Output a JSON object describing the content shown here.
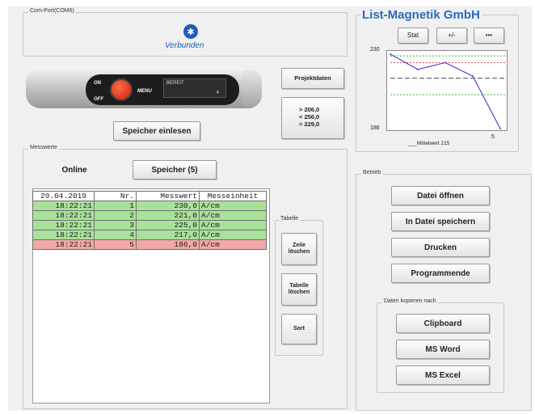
{
  "com_port": {
    "label": "Com-Port(COM6)",
    "status": "Verbunden",
    "status_icon": "bluetooth-icon"
  },
  "device": {
    "on_label": "ON",
    "off_label": "OFF",
    "menu_label": "MENU",
    "display_text": "BEREIT",
    "display_suffix": "4"
  },
  "buttons": {
    "speicher_einlesen": "Speicher einlesen",
    "projektdaten": "Projektdaten"
  },
  "limits": {
    "line1": "> 206,0",
    "line2": "< 256,0",
    "line3": "= 229,0"
  },
  "messwerte": {
    "label": "Messwerte",
    "tab_online": "Online",
    "tab_speicher": "Speicher (5)",
    "headers": [
      "29.04.2019",
      "Nr.",
      "Messwert",
      "Messeinheit"
    ],
    "rows": [
      {
        "time": "18:22:21",
        "nr": "1",
        "value": "230,0",
        "unit": "A/cm",
        "status": "ok"
      },
      {
        "time": "18:22:21",
        "nr": "2",
        "value": "221,0",
        "unit": "A/cm",
        "status": "ok"
      },
      {
        "time": "18:22:21",
        "nr": "3",
        "value": "225,0",
        "unit": "A/cm",
        "status": "ok"
      },
      {
        "time": "18:22:21",
        "nr": "4",
        "value": "217,0",
        "unit": "A/cm",
        "status": "ok"
      },
      {
        "time": "18:22:21",
        "nr": "5",
        "value": "186,0",
        "unit": "A/cm",
        "status": "bad"
      }
    ]
  },
  "tabelle": {
    "label": "Tabelle",
    "zeile_loeschen": "Zeile\nlöschen",
    "tabelle_loeschen": "Tabelle\nlöschen",
    "sort": "Sort"
  },
  "company": {
    "title": "List-Magnetik GmbH",
    "btn_stat": "Stat",
    "btn_plusminus": "+/-",
    "btn_dots": "•••"
  },
  "chart_data": {
    "type": "line",
    "x": [
      1,
      2,
      3,
      4,
      5
    ],
    "values": [
      230,
      221,
      225,
      217,
      186
    ],
    "ylim": [
      186,
      230
    ],
    "ytick_labels": [
      "230",
      "186"
    ],
    "xtick_labels": [
      "5"
    ],
    "legend_text": "Mittelwert 215",
    "series_color": "#4a4ac8",
    "mean_color": "#444444",
    "upper_color": "#e05050",
    "lower_color": "#3ab83a"
  },
  "betrieb": {
    "label": "Betrieb",
    "datei_oeffnen": "Datei öffnen",
    "in_datei_speichern": "In Datei speichern",
    "drucken": "Drucken",
    "programmende": "Programmende"
  },
  "kopieren": {
    "label": "Daten kopieren nach",
    "clipboard": "Clipboard",
    "ms_word": "MS Word",
    "ms_excel": "MS Excel"
  }
}
